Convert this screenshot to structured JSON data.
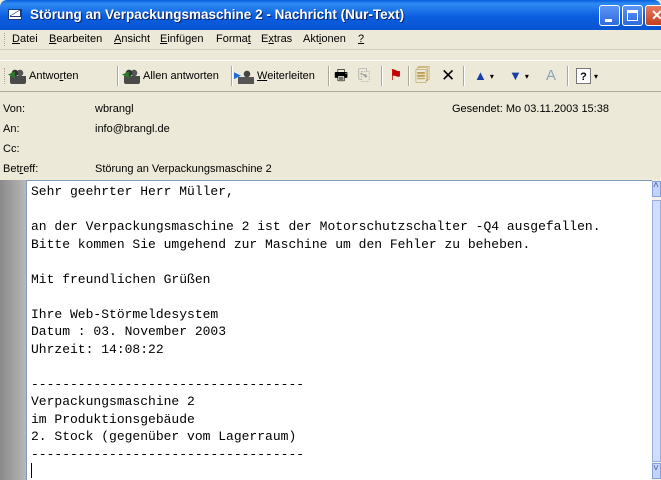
{
  "window": {
    "title": "Störung an Verpackungsmaschine 2 - Nachricht (Nur-Text)"
  },
  "menu": {
    "items": [
      {
        "pre": "",
        "u": "D",
        "post": "atei"
      },
      {
        "pre": "",
        "u": "B",
        "post": "earbeiten"
      },
      {
        "pre": "",
        "u": "A",
        "post": "nsicht"
      },
      {
        "pre": "",
        "u": "E",
        "post": "infügen"
      },
      {
        "pre": "Forma",
        "u": "t",
        "post": ""
      },
      {
        "pre": "E",
        "u": "x",
        "post": "tras"
      },
      {
        "pre": "Akt",
        "u": "i",
        "post": "onen"
      },
      {
        "pre": "",
        "u": "?",
        "post": ""
      }
    ]
  },
  "toolbar": {
    "reply": {
      "pre": "Antwo",
      "u": "r",
      "post": "ten"
    },
    "reply_all": "Allen antworten",
    "forward": {
      "pre": "",
      "u": "W",
      "post": "eiterleiten"
    }
  },
  "headers": {
    "from_label": "Von:",
    "from": "wbrangl",
    "to_label": "An:",
    "to": "info@brangl.de",
    "cc_label": "Cc:",
    "cc": "",
    "subject_label": {
      "pre": "Bet",
      "u": "r",
      "post": "eff:"
    },
    "subject": "Störung an Verpackungsmaschine 2",
    "sent": "Gesendet: Mo 03.11.2003 15:38"
  },
  "body": "Sehr geehrter Herr Müller,\n\nan der Verpackungsmaschine 2 ist der Motorschutzschalter -Q4 ausgefallen.\nBitte kommen Sie umgehend zur Maschine um den Fehler zu beheben.\n\nMit freundlichen Grüßen\n\nIhre Web-Störmeldesystem\nDatum : 03. November 2003\nUhrzeit: 14:08:22\n\n-----------------------------------\nVerpackungsmaschine 2\nim Produktionsgebäude\n2. Stock (gegenüber vom Lagerraum)\n-----------------------------------"
}
